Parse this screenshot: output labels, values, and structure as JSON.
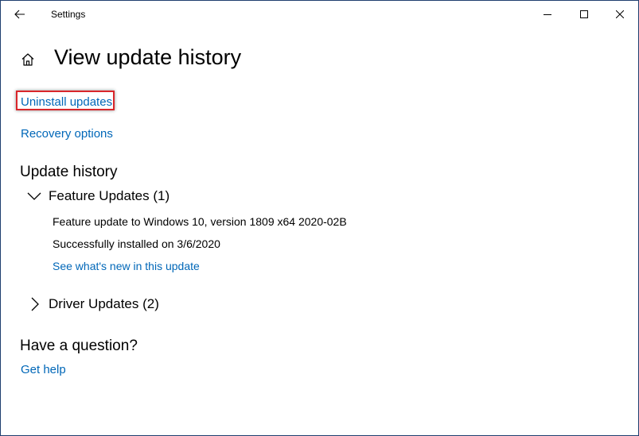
{
  "window": {
    "title": "Settings",
    "controls": {
      "minimize_icon": "minimize-icon",
      "maximize_icon": "maximize-icon",
      "close_icon": "close-icon"
    },
    "back_icon": "back-arrow-icon"
  },
  "page": {
    "home_icon": "home-icon",
    "title": "View update history"
  },
  "links": {
    "uninstall": "Uninstall updates",
    "recovery": "Recovery options"
  },
  "history": {
    "title": "Update history",
    "groups": [
      {
        "label": "Feature Updates (1)",
        "expanded": true,
        "items": [
          {
            "name": "Feature update to Windows 10, version 1809 x64 2020-02B",
            "status": "Successfully installed on 3/6/2020",
            "link": "See what's new in this update"
          }
        ]
      },
      {
        "label": "Driver Updates (2)",
        "expanded": false,
        "items": []
      }
    ]
  },
  "help": {
    "title": "Have a question?",
    "link": "Get help"
  },
  "colors": {
    "link": "#0067b8",
    "highlight_border": "#d9262b",
    "window_border": "#1f3f6f"
  }
}
